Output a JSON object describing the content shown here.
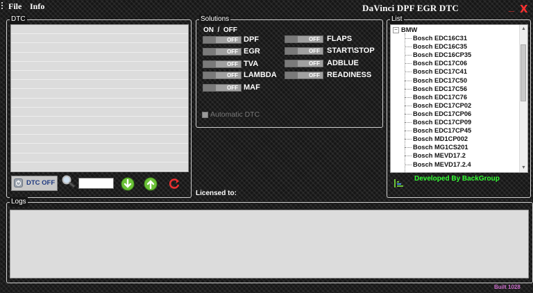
{
  "menu": {
    "file": "File",
    "info": "Info"
  },
  "window": {
    "title": "DaVinci DPF EGR DTC",
    "minimize": "_",
    "close": "X"
  },
  "dtc": {
    "legend": "DTC",
    "dtc_off_label": "DTC OFF",
    "search_value": ""
  },
  "solutions": {
    "legend": "Solutions",
    "header": "ON  /  OFF",
    "toggle_text": "OFF",
    "left": [
      "DPF",
      "EGR",
      "TVA",
      "LAMBDA",
      "MAF"
    ],
    "right": [
      "FLAPS",
      "START\\STOP",
      "ADBLUE",
      "READINESS"
    ],
    "automatic_dtc": "Automatic DTC"
  },
  "list": {
    "legend": "List",
    "root": "BMW",
    "items": [
      "Bosch EDC16C31",
      "Bosch EDC16C35",
      "Bosch EDC16CP35",
      "Bosch EDC17C06",
      "Bosch EDC17C41",
      "Bosch EDC17C50",
      "Bosch EDC17C56",
      "Bosch EDC17C76",
      "Bosch EDC17CP02",
      "Bosch EDC17CP06",
      "Bosch EDC17CP09",
      "Bosch EDC17CP45",
      "Bosch MD1CP002",
      "Bosch MG1CS201",
      "Bosch MEVD17.2",
      "Bosch MEVD17.2.4"
    ],
    "footer": "Developed By BackGroup"
  },
  "license": {
    "label": "Licensed to:"
  },
  "logs": {
    "legend": "Logs"
  },
  "build": {
    "label": "Built 1028"
  },
  "colors": {
    "title_close": "#ff3030",
    "developed": "#33ff33",
    "build": "#d070d0",
    "tree_line": "#888888"
  },
  "icons": {
    "dtc_off": "power-icon",
    "search": "magnifier-icon",
    "down": "green-down-arrow-icon",
    "up": "green-up-arrow-icon",
    "refresh": "red-refresh-icon",
    "list_sort": "sort-bars-icon"
  }
}
